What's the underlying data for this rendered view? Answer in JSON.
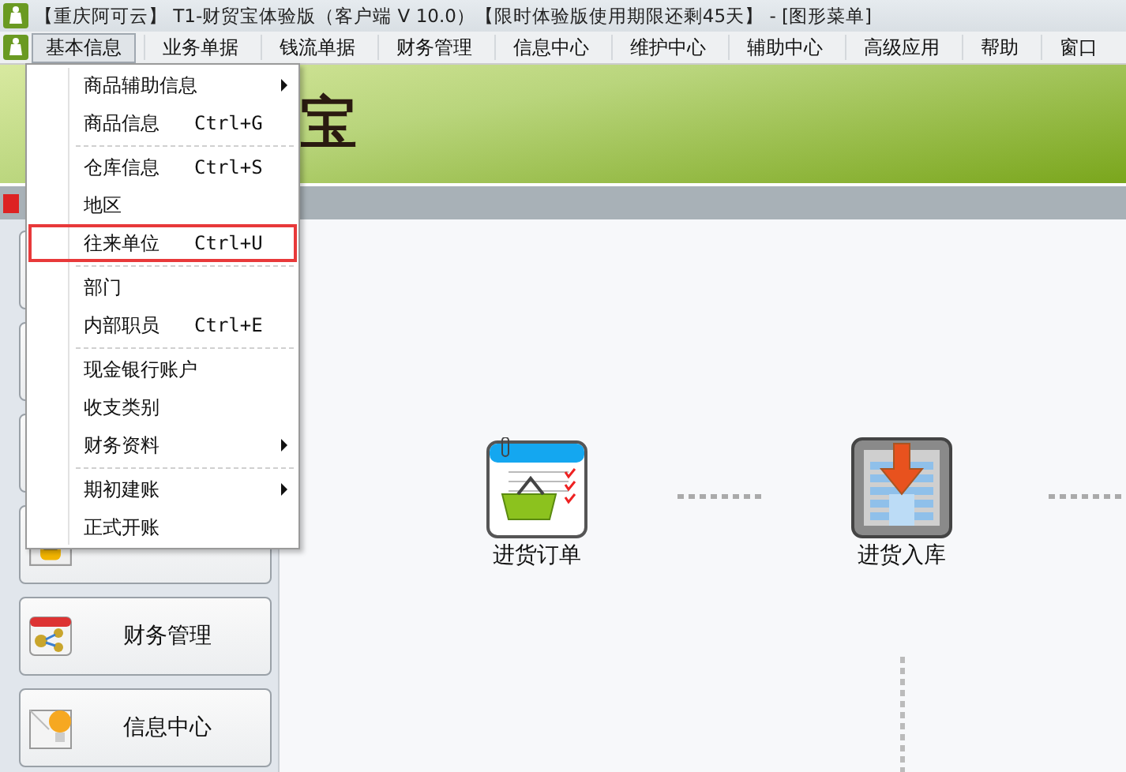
{
  "window": {
    "title": "【重庆阿可云】 T1-财贸宝体验版（客户端 V 10.0）【限时体验版使用期限还剩45天】 - [图形菜单]"
  },
  "menu_bar": [
    {
      "label": "基本信息",
      "selected": true
    },
    {
      "label": "业务单据",
      "selected": false
    },
    {
      "label": "钱流单据",
      "selected": false
    },
    {
      "label": "财务管理",
      "selected": false
    },
    {
      "label": "信息中心",
      "selected": false
    },
    {
      "label": "维护中心",
      "selected": false
    },
    {
      "label": "辅助中心",
      "selected": false
    },
    {
      "label": "高级应用",
      "selected": false
    },
    {
      "label": "帮助",
      "selected": false
    },
    {
      "label": "窗口",
      "selected": false
    }
  ],
  "dropdown": [
    {
      "label": "商品辅助信息",
      "submenu": true,
      "separator_after": false,
      "selected": false
    },
    {
      "label": "商品信息",
      "shortcut": "Ctrl+G",
      "submenu": false,
      "separator_after": true,
      "selected": false
    },
    {
      "label": "仓库信息",
      "shortcut": "Ctrl+S",
      "submenu": false,
      "separator_after": false,
      "selected": false
    },
    {
      "label": "地区",
      "submenu": false,
      "separator_after": false,
      "selected": false
    },
    {
      "label": "往来单位",
      "shortcut": "Ctrl+U",
      "submenu": false,
      "separator_after": true,
      "selected": true
    },
    {
      "label": "部门",
      "submenu": false,
      "separator_after": false,
      "selected": false
    },
    {
      "label": "内部职员",
      "shortcut": "Ctrl+E",
      "submenu": false,
      "separator_after": true,
      "selected": false
    },
    {
      "label": "现金银行账户",
      "submenu": false,
      "separator_after": false,
      "selected": false
    },
    {
      "label": "收支类别",
      "submenu": false,
      "separator_after": false,
      "selected": false
    },
    {
      "label": "财务资料",
      "submenu": true,
      "separator_after": true,
      "selected": false
    },
    {
      "label": "期初建账",
      "submenu": true,
      "separator_after": false,
      "selected": false
    },
    {
      "label": "正式开账",
      "submenu": false,
      "separator_after": false,
      "selected": false
    }
  ],
  "banner": {
    "text": "宝"
  },
  "sidebar": [
    {
      "kind": "blank"
    },
    {
      "kind": "blank"
    },
    {
      "kind": "blank"
    },
    {
      "kind": "cash"
    },
    {
      "kind": "finance",
      "label": "财务管理"
    },
    {
      "kind": "info",
      "label": "信息中心"
    }
  ],
  "flow": [
    {
      "kind": "order",
      "label": "进货订单"
    },
    {
      "kind": "stockin",
      "label": "进货入库"
    }
  ]
}
